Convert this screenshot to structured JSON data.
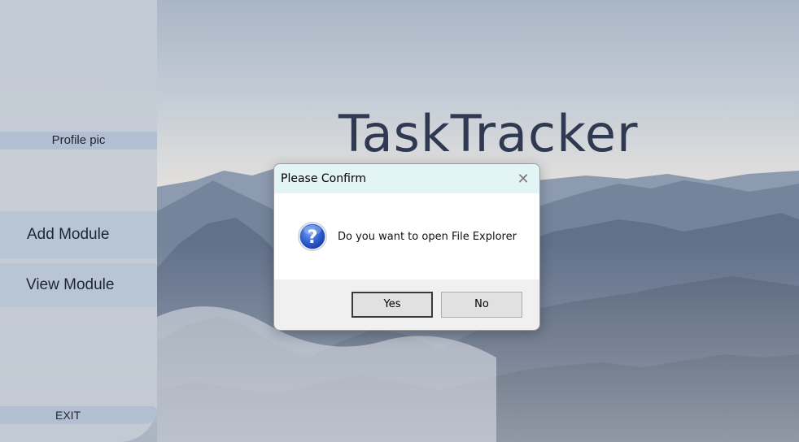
{
  "app": {
    "title": "TaskTracker"
  },
  "sidebar": {
    "profile_label": "Profile pic",
    "add_module_label": "Add Module",
    "view_module_label": "View Module",
    "exit_label": "EXIT"
  },
  "dialog": {
    "title": "Please Confirm",
    "close_icon": "close-icon",
    "icon": "question-icon",
    "message": "Do you want to open File Explorer",
    "yes_label": "Yes",
    "no_label": "No"
  },
  "colors": {
    "sidebar_bg": "#c4cbd4",
    "sidebar_button": "#b8c5d4",
    "title_text": "#2f3a52",
    "dialog_titlebar": "#e3f4f6"
  }
}
